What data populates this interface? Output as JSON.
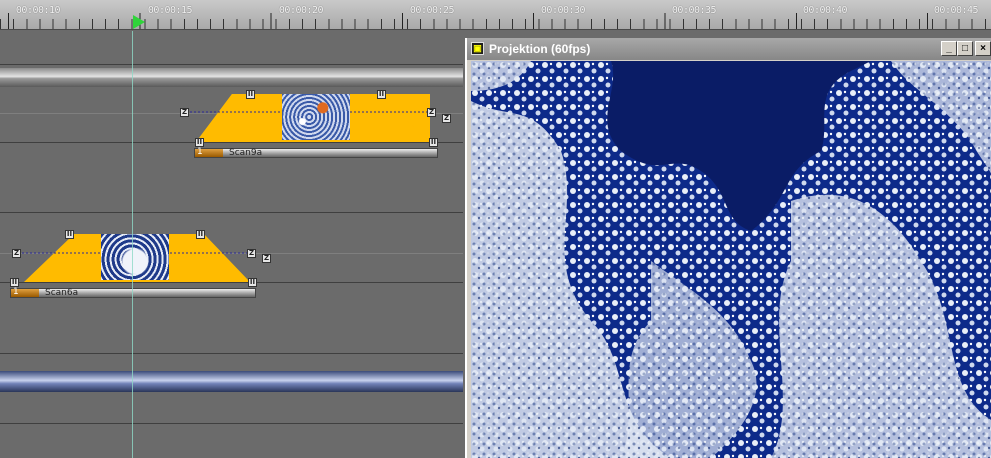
{
  "ruler": {
    "timecodes": [
      "00:00:10",
      "00:00:15",
      "00:00:20",
      "00:00:25",
      "00:00:30",
      "00:00:35",
      "00:00:40",
      "00:00:45"
    ]
  },
  "timeline": {
    "clips": [
      {
        "name": "Scan9a",
        "number": "1",
        "handle_top": "II",
        "handle_side": "Z"
      },
      {
        "name": "Scan6a",
        "number": "1",
        "handle_top": "II",
        "handle_side": "Z"
      }
    ]
  },
  "projection": {
    "title": "Projektion (60fps)",
    "minimize": "_",
    "maximize": "□",
    "close": "×",
    "icon": "projector-icon"
  },
  "colors": {
    "clip_yellow": "#ffbb00",
    "playhead_green": "#2fd43a",
    "sky_blue": "#0a1c66"
  }
}
